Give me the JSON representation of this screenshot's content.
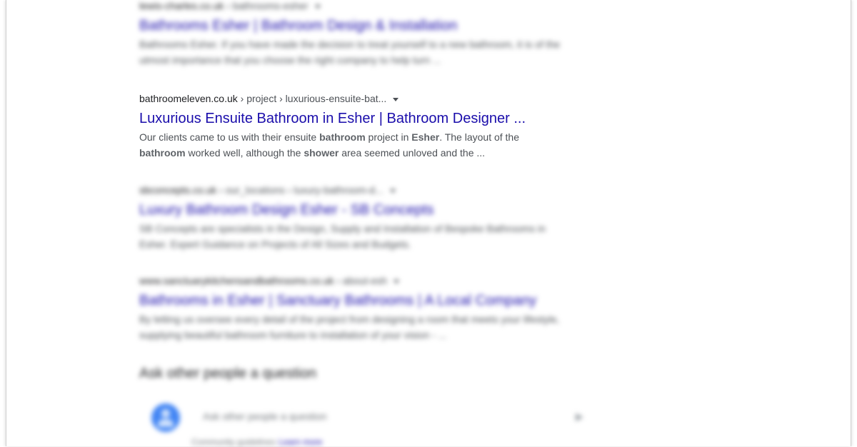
{
  "results": [
    {
      "cite_domain": "lewis-charles.co.uk",
      "cite_path": " › bathrooms-esher",
      "title": "Bathrooms Esher | Bathroom Design & Installation",
      "snippet_line1": "Bathrooms Esher. If you have made the decision to treat yourself to a new bathroom, it is of the",
      "snippet_line2": "utmost importance that you choose the right company to help turn ..."
    },
    {
      "cite_domain": "bathroomeleven.co.uk",
      "cite_path": " › project › luxurious-ensuite-bat...",
      "title": "Luxurious Ensuite Bathroom in Esher | Bathroom Designer ...",
      "snippet": {
        "s1": "Our clients came to us with their ensuite ",
        "b1": "bathroom",
        "s2": " project in ",
        "b2": "Esher",
        "s3": ". The layout of the",
        "b3": "bathroom",
        "s4": " worked well, although the ",
        "b4": "shower",
        "s5": " area seemed unloved and the ..."
      }
    },
    {
      "cite_domain": "sbconcepts.co.uk",
      "cite_path": " › our_locations › luxury-bathroom-d...",
      "title": "Luxury Bathroom Design Esher - SB Concepts",
      "snippet_line1": "SB Concepts are specialists in the Design, Supply and Installation of Bespoke Bathrooms in",
      "snippet_line2": "Esher. Expert Guidance on Projects of All Sizes and Budgets."
    },
    {
      "cite_domain": "www.sanctuarykitchensandbathrooms.co.uk",
      "cite_path": " › about-esh",
      "title": "Bathrooms in Esher | Sanctuary Bathrooms | A Local Company",
      "snippet_line1": "By letting us oversee every detail of the project from designing a room that meets your lifestyle,",
      "snippet_line2": "supplying beautiful bathroom furniture to installation of your vision - ..."
    }
  ],
  "paa": {
    "heading": "Ask other people a question",
    "placeholder": "Ask other people a question",
    "send_icon": "send-icon",
    "avatar_icon": "person-avatar-icon",
    "footer_text": "Community guidelines",
    "footer_link": "Learn more"
  },
  "colors": {
    "link": "#1a0dab",
    "cite": "#202124",
    "snippet": "#4d5156",
    "avatar": "#4285f4"
  }
}
